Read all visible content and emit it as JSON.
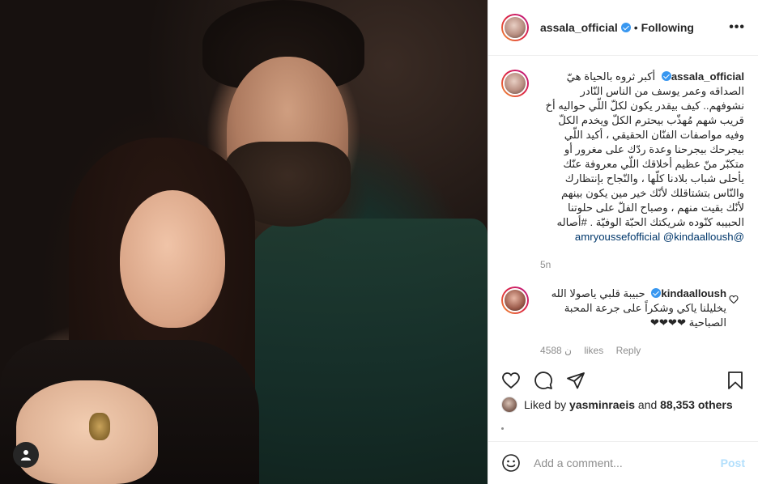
{
  "post": {
    "username": "assala_official",
    "following_label": "Following",
    "more_label": "•••",
    "colors": {
      "verified": "#3897f0",
      "mention": "#00376b",
      "post_button": "#b2dffc",
      "muted": "#8e8e8e"
    }
  },
  "caption": {
    "username": "assala_official",
    "text": "أكبر ثروه بالحياة هيّ الصداقه وعمر يوسف من الناس النّادر نشوفهم.. كيف بيقدر يكون لكلّ اللّي حواليه أخ قريب شهم مُهذّب بيحترم الكلّ ويخدم الكلّ وفيه مواصفات الفنّان الحقيقي ، أكيد اللّي بيجرحك بيجرحنا وعدة ردّك على مغرور أو متكبّر منّ عظيم أخلاقك اللّي معروفة عنّك يأحلى شباب بلادنا كلّها ، والنّجاح بإنتظارك والنّاس بتشتاقلك لأنّك خير مين يكون بينهم لأنّك بقيت منهم ، وصباح الفلّ على حلوتنا الحبيبه كنّوده شريكتك الحبّة الوفيّة . #أصاله",
    "mention1": "@amryoussefofficial",
    "mention2": "@kindaalloush",
    "time": "5n"
  },
  "comment": {
    "username": "kindaalloush",
    "text": "حبيبة قلبي ياصولا الله يخليلنا ياكي وشكراً على جرعة المحبة الصباحية ❤❤❤❤",
    "time": "4‏ن",
    "likes": "588 likes",
    "reply_label": "Reply"
  },
  "likes": {
    "prefix": "Liked by",
    "user": "yasminraeis",
    "suffix": "and",
    "count": "88,353 others"
  },
  "add_comment": {
    "placeholder": "Add a comment...",
    "post_label": "Post"
  },
  "icons": [
    "user-tag-icon",
    "verified-icon",
    "more-icon",
    "heart-icon",
    "comment-icon",
    "share-icon",
    "save-icon",
    "emoji-icon"
  ]
}
